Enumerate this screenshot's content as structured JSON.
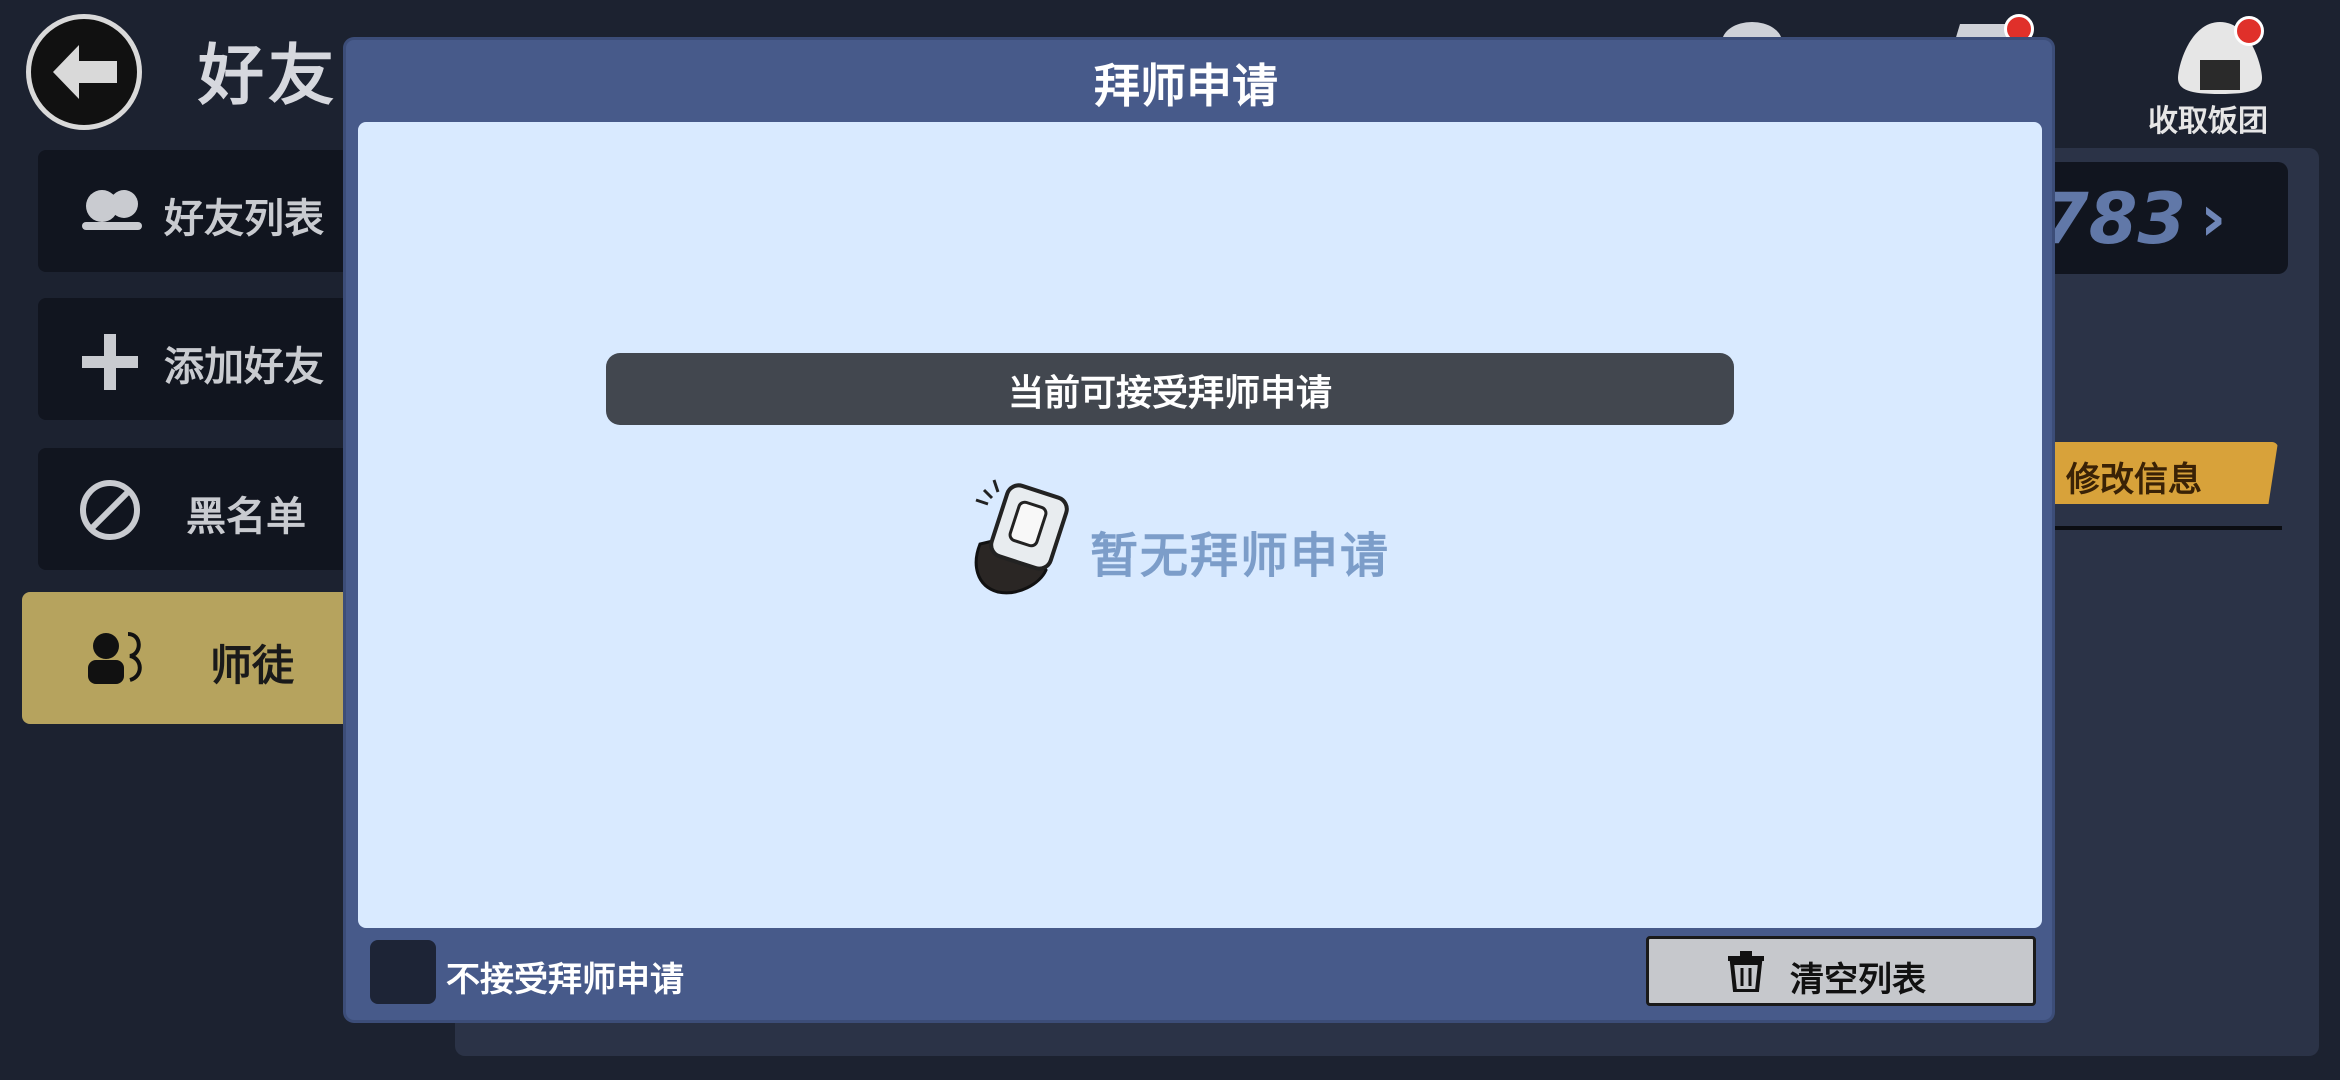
{
  "header": {
    "title": "好友"
  },
  "top_right": {
    "collect_label": "收取饭团"
  },
  "sidebar": {
    "items": [
      {
        "label": "好友列表",
        "icon": "friends-icon"
      },
      {
        "label": "添加好友",
        "icon": "plus-icon"
      },
      {
        "label": "黑名单",
        "icon": "block-icon"
      },
      {
        "label": "师徒",
        "icon": "mentor-icon",
        "active": true
      }
    ]
  },
  "profile": {
    "id_fragment": "783",
    "edit_label": "修改信息"
  },
  "modal": {
    "title": "拜师申请",
    "status_text": "当前可接受拜师申请",
    "empty_text": "暂无拜师申请",
    "checkbox_label": "不接受拜师申请",
    "clear_label": "清空列表"
  },
  "colors": {
    "modal_frame": "#475a8a",
    "modal_body": "#d9eaff",
    "active_tab": "#b6a35e",
    "accent_orange": "#d8a23a"
  }
}
